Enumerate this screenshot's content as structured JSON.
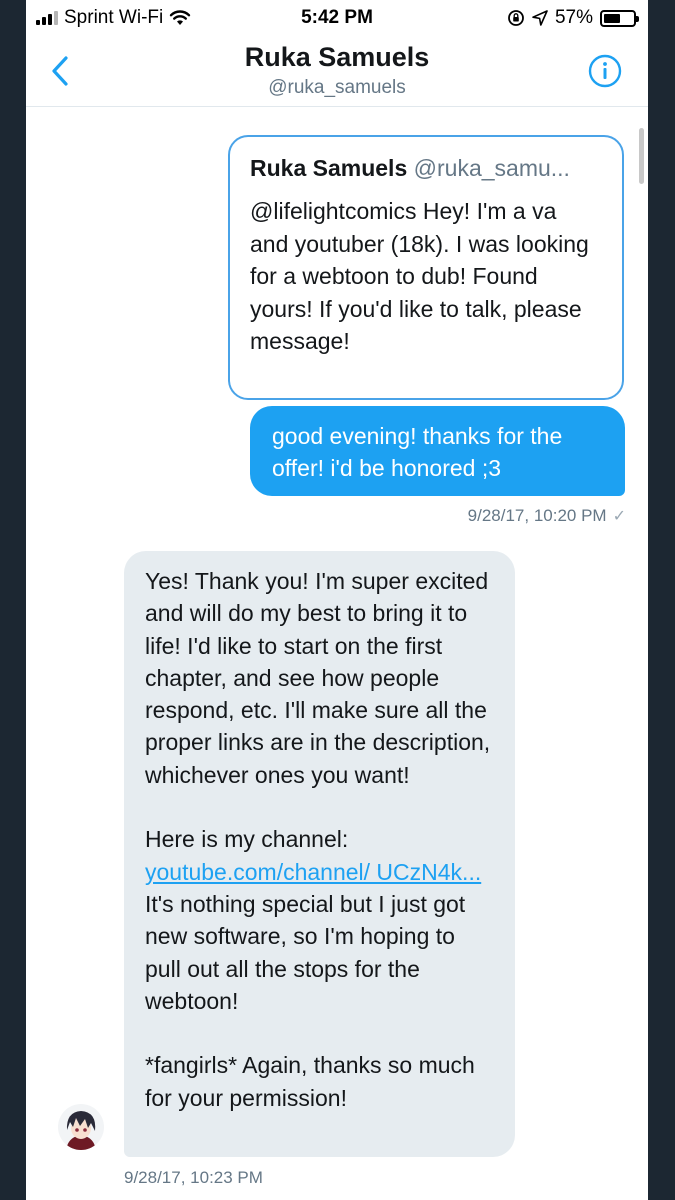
{
  "status_bar": {
    "carrier": "Sprint Wi-Fi",
    "time": "5:42 PM",
    "battery": "57%",
    "battery_level": 0.57,
    "signal_bars_filled": 3,
    "signal_bars_total": 4
  },
  "header": {
    "title": "Ruka Samuels",
    "subtitle": "@ruka_samuels"
  },
  "conversation": {
    "quoted_tweet": {
      "author_name": "Ruka Samuels",
      "author_handle": "@ruka_samu...",
      "text": "@lifelightcomics Hey! I'm a va and youtuber (18k). I was looking for a webtoon to dub! Found yours! If you'd like to talk, please message!"
    },
    "sent_message": {
      "text": "good evening! thanks for the offer! i'd be honored ;3",
      "timestamp": "9/28/17, 10:20 PM"
    },
    "received_message": {
      "paragraph_1": "Yes! Thank you! I'm super excited and will do my best to bring it to life! I'd like to start on the first chapter, and see how people respond, etc. I'll make sure all the proper links are in the description, whichever ones you want!",
      "channel_intro": "Here is my channel:",
      "channel_link": "youtube.com/channel/ UCzN4k...",
      "paragraph_2_rest": " It's nothing special but I just got new software, so I'm hoping to pull out all the stops for the webtoon!",
      "paragraph_3": "*fangirls* Again, thanks so much for your permission!",
      "timestamp": "9/28/17, 10:23 PM"
    }
  },
  "colors": {
    "accent": "#1da1f2",
    "quote_border": "#4aa3e8",
    "received_bubble": "#e6ecf0",
    "meta_text": "#657786",
    "outer_background": "#1c2732"
  },
  "icons": {
    "back": "chevron-left-icon",
    "info": "info-circle-icon",
    "wifi": "wifi-icon",
    "location": "location-arrow-icon",
    "lock": "rotation-lock-icon",
    "read": "checkmark-icon"
  }
}
